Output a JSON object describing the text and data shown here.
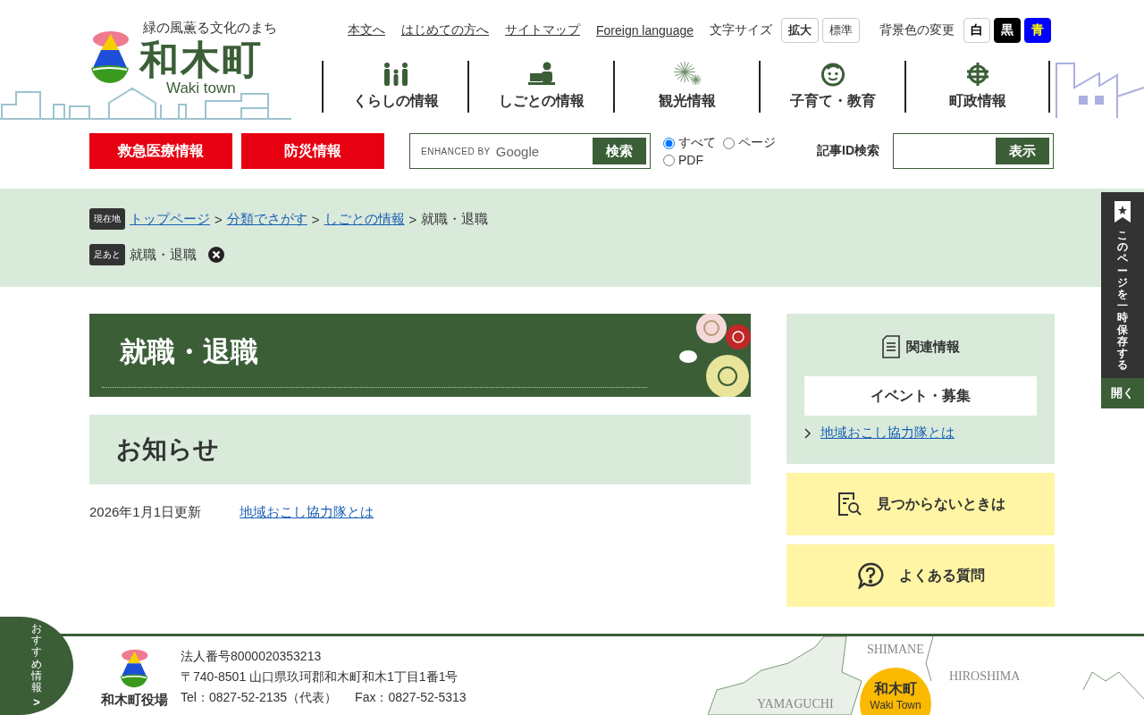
{
  "header": {
    "tagline": "緑の風薫る文化のまち",
    "town_name": "和木町",
    "town_name_en": "Waki town",
    "utility_links": [
      "本文へ",
      "はじめての方へ",
      "サイトマップ",
      "Foreign language"
    ],
    "font_size": {
      "label": "文字サイズ",
      "buttons": [
        {
          "label": "拡大",
          "kind": "enlarge"
        },
        {
          "label": "標準",
          "kind": "standard"
        }
      ]
    },
    "background_color": {
      "label": "背景色の変更",
      "buttons": [
        {
          "label": "白",
          "kind": "white"
        },
        {
          "label": "黒",
          "kind": "black"
        },
        {
          "label": "青",
          "kind": "blue"
        }
      ]
    }
  },
  "nav": [
    {
      "label": "くらしの情報",
      "kind": "family"
    },
    {
      "label": "しごとの情報",
      "kind": "work"
    },
    {
      "label": "観光情報",
      "kind": "fireworks"
    },
    {
      "label": "子育て・教育",
      "kind": "child"
    },
    {
      "label": "町政情報",
      "kind": "town"
    }
  ],
  "emergency_buttons": [
    "救急医療情報",
    "防災情報"
  ],
  "search": {
    "branding": "ENHANCED BY",
    "brand": "Google",
    "button": "検索",
    "scopes": [
      {
        "label": "すべて",
        "selected": true
      },
      {
        "label": "ページ",
        "selected": false
      },
      {
        "label": "PDF",
        "selected": false
      }
    ]
  },
  "article_id_search": {
    "label": "記事ID検索",
    "button": "表示"
  },
  "breadcrumb": {
    "label": "現在地",
    "items": [
      {
        "text": "トップページ",
        "kind": "link"
      },
      {
        "text": ">",
        "kind": "separator"
      },
      {
        "text": "分類でさがす",
        "kind": "link"
      },
      {
        "text": ">",
        "kind": "separator"
      },
      {
        "text": "しごとの情報",
        "kind": "link"
      },
      {
        "text": ">",
        "kind": "separator"
      },
      {
        "text": "就職・退職",
        "kind": "current"
      }
    ]
  },
  "footprint": {
    "label": "足あと",
    "items": [
      "就職・退職"
    ]
  },
  "page_title": "就職・退職",
  "section": {
    "heading": "お知らせ",
    "entries": [
      {
        "date": "2026年1月1日更新",
        "link": "地域おこし協力隊とは"
      }
    ]
  },
  "sidebar": {
    "related": {
      "heading": "関連情報",
      "category": "イベント・募集",
      "links": [
        "地域おこし協力隊とは"
      ]
    },
    "buttons": [
      {
        "label": "見つからないときは",
        "kind": "search-doc"
      },
      {
        "label": "よくある質問",
        "kind": "question"
      }
    ]
  },
  "save_tab": {
    "label": "このページを一時保存する",
    "button": "開く"
  },
  "recommend_tab": {
    "label": "おすすめ情報",
    "arrow": ">"
  },
  "footer": {
    "office": "和木町役場",
    "lines": [
      "法人番号8000020353213",
      "〒740-8501 山口県玖珂郡和木町和木1丁目1番1号"
    ],
    "tel": "Tel：0827-52-2135（代表）",
    "fax": "Fax：0827-52-5313",
    "map": {
      "labels": [
        "SHIMANE",
        "HIROSHIMA",
        "YAMAGUCHI"
      ],
      "marker": "和木町",
      "marker_en": "Waki Town"
    }
  }
}
